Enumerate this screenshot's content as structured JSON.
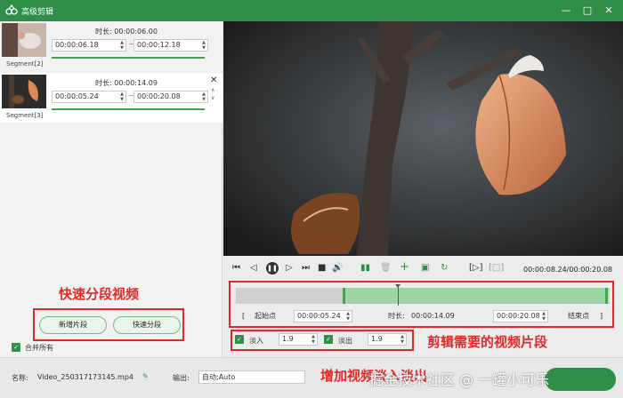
{
  "window": {
    "title": "高级剪辑",
    "minimize": "—",
    "maximize": "□",
    "close": "✕"
  },
  "segments": [
    {
      "label": "Segment[2]",
      "duration_label": "时长:",
      "duration": "00:00:06.00",
      "start": "00:00:06.18",
      "end": "00:00:12.18"
    },
    {
      "label": "Segment[3]",
      "duration_label": "时长:",
      "duration": "00:00:14.09",
      "start": "00:00:05.24",
      "end": "00:00:20.08"
    }
  ],
  "segment_separator": "~",
  "left_actions": {
    "add_segment": "新增片段",
    "quick_split": "快速分段"
  },
  "merge_all": "合并所有",
  "annotations": {
    "quick": "快速分段视频",
    "cut": "剪辑需要的视频片段",
    "fade": "增加视频淡入淡出"
  },
  "player": {
    "time": "00:00:08.24/00:00:20.08"
  },
  "trim": {
    "start_label": "起始点",
    "start_value": "00:00:05.24",
    "duration_label": "时长:",
    "duration_value": "00:00:14.09",
    "end_value": "00:00:20.08",
    "end_label": "结束点",
    "bracket_open": "[",
    "bracket_close": "]"
  },
  "fade": {
    "in_label": "淡入",
    "in_value": "1.9",
    "out_label": "淡出",
    "out_value": "1.9"
  },
  "bottom": {
    "name_label": "名称:",
    "name_value": "Video_250317173145.mp4",
    "output_label": "输出:",
    "output_value": "自动;Auto"
  },
  "watermark": "掘金技术社区 @ 一罐小可乐",
  "colors": {
    "brand": "#2f8f48",
    "annotation": "#e02a2a"
  }
}
